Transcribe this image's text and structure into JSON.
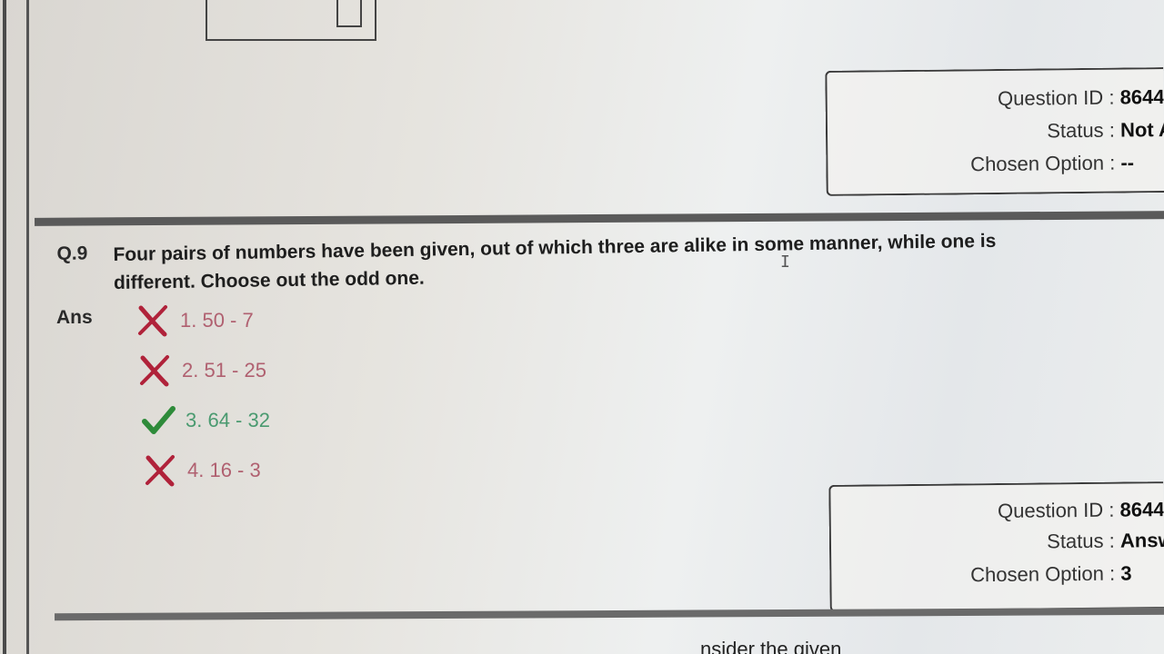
{
  "panels": {
    "top": {
      "question_id_label": "Question ID",
      "question_id_value": "8644",
      "status_label": "Status",
      "status_value": "Not A",
      "chosen_label": "Chosen Option",
      "chosen_value": "--"
    },
    "bottom": {
      "question_id_label": "Question ID",
      "question_id_value": "8644",
      "status_label": "Status",
      "status_value": "Answ",
      "chosen_label": "Chosen Option",
      "chosen_value": "3"
    },
    "separator": ":"
  },
  "question": {
    "number": "Q.9",
    "text": "Four pairs of numbers have been given, out of which three are alike in some manner, while one is different. Choose out the odd one."
  },
  "answer": {
    "label": "Ans",
    "options": [
      {
        "text": "1. 50 - 7",
        "result": "wrong",
        "icon": "cross-icon"
      },
      {
        "text": "2. 51 - 25",
        "result": "wrong",
        "icon": "cross-icon"
      },
      {
        "text": "3. 64 - 32",
        "result": "correct",
        "icon": "check-icon"
      },
      {
        "text": "4. 16 - 3",
        "result": "wrong",
        "icon": "cross-icon"
      }
    ]
  },
  "footer": {
    "partial_text": "nsider the given"
  },
  "colors": {
    "wrong": "#b0223a",
    "correct": "#2e8b3a",
    "wrong_text": "#b06070",
    "correct_text": "#4a9a70"
  }
}
